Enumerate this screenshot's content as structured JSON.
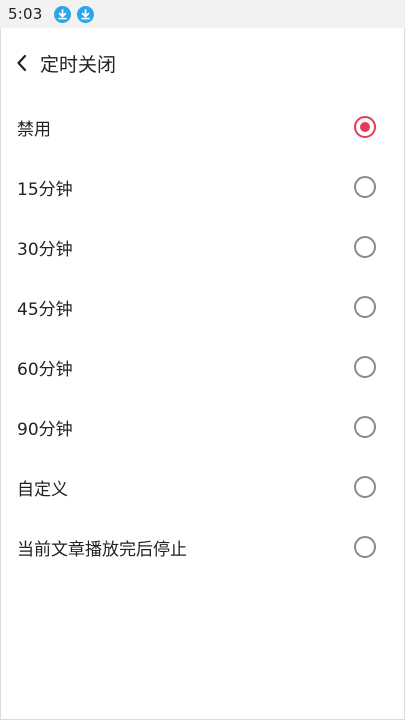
{
  "status_bar": {
    "time": "5:03",
    "icons": [
      "download-icon",
      "download-icon"
    ],
    "icon_color": "#2aa6ea"
  },
  "header": {
    "back_icon": "chevron-left-icon",
    "title": "定时关闭"
  },
  "options": [
    {
      "label": "禁用",
      "selected": true
    },
    {
      "label": "15分钟",
      "selected": false
    },
    {
      "label": "30分钟",
      "selected": false
    },
    {
      "label": "45分钟",
      "selected": false
    },
    {
      "label": "60分钟",
      "selected": false
    },
    {
      "label": "90分钟",
      "selected": false
    },
    {
      "label": "自定义",
      "selected": false
    },
    {
      "label": "当前文章播放完后停止",
      "selected": false
    }
  ],
  "colors": {
    "accent": "#e8395a",
    "radio_unchecked": "#8a8a8a",
    "status_bar_bg": "#f2f2f2"
  }
}
